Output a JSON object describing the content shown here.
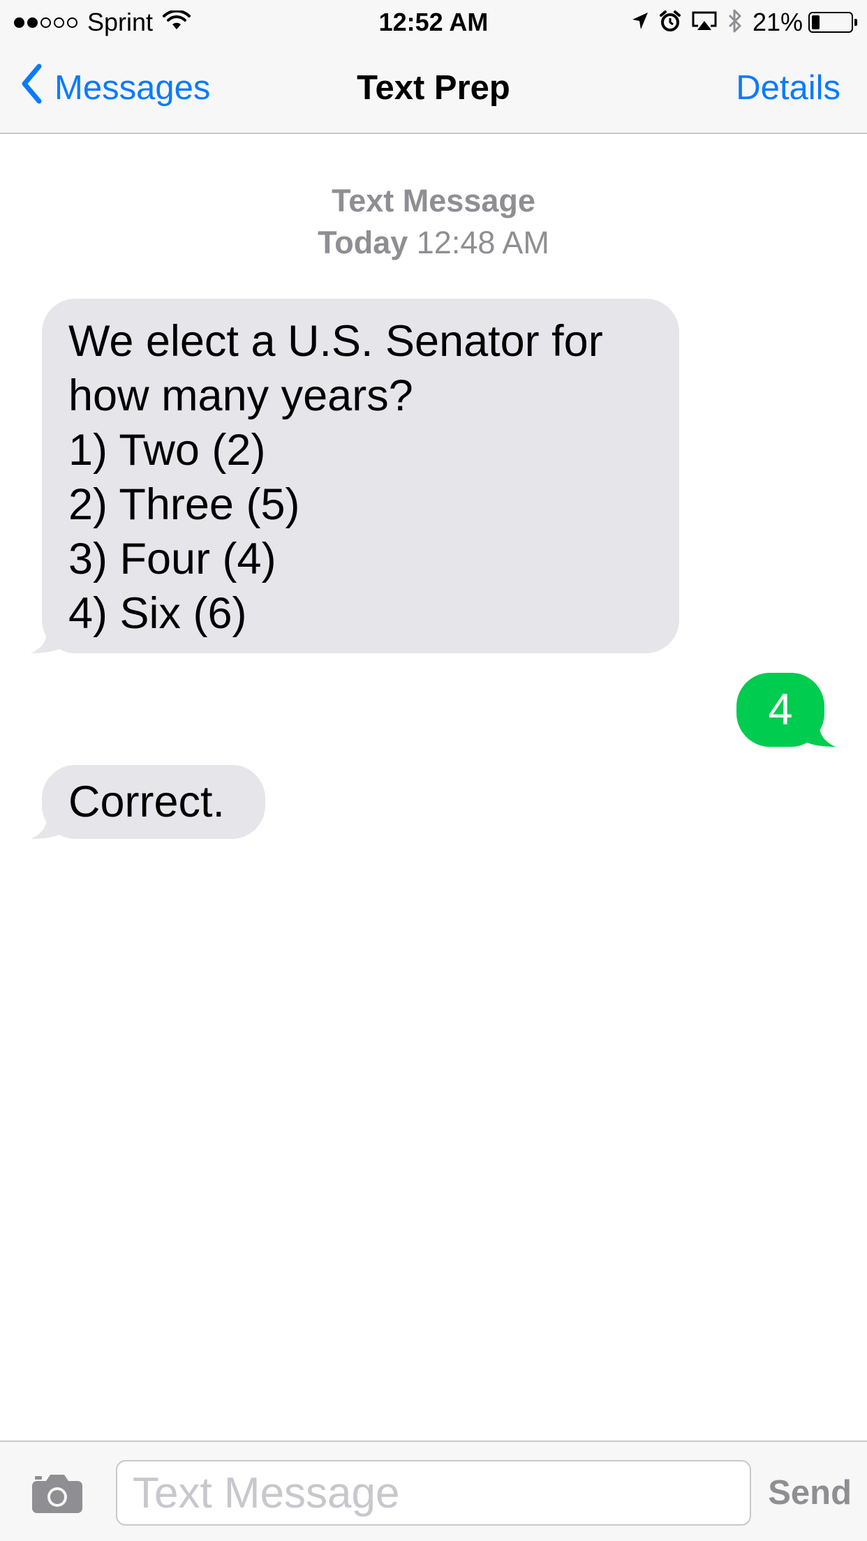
{
  "status_bar": {
    "carrier": "Sprint",
    "signal_bars_filled": 2,
    "signal_bars_total": 5,
    "time": "12:52 AM",
    "battery_percent": "21%",
    "battery_level": 0.21
  },
  "nav": {
    "back_label": "Messages",
    "title": "Text Prep",
    "details_label": "Details"
  },
  "conversation": {
    "service": "Text Message",
    "day": "Today",
    "time": "12:48 AM",
    "messages": [
      {
        "direction": "incoming",
        "lines": [
          "We elect a U.S. Senator for",
          "how many years?",
          "1) Two (2)",
          "2) Three (5)",
          "3) Four (4)",
          "4) Six (6)"
        ]
      },
      {
        "direction": "outgoing",
        "text": "4"
      },
      {
        "direction": "incoming",
        "text": "Correct."
      }
    ]
  },
  "input_bar": {
    "placeholder": "Text Message",
    "value": "",
    "send_label": "Send"
  },
  "colors": {
    "accent": "#0a7aff",
    "incoming_bubble": "#e5e5ea",
    "outgoing_bubble": "#00cc4f",
    "meta_text": "#8e8e93"
  },
  "icons": [
    "chevron-left-icon",
    "wifi-icon",
    "location-icon",
    "alarm-icon",
    "airplay-icon",
    "bluetooth-icon",
    "battery-icon",
    "camera-icon"
  ]
}
